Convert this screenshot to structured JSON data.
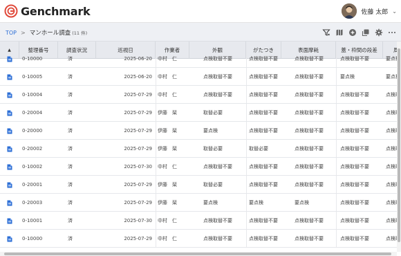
{
  "app": {
    "brand": "Genchmark"
  },
  "user": {
    "name": "佐藤 太郎",
    "caret": "⌄"
  },
  "breadcrumb": {
    "top": "TOP",
    "separator": ">",
    "page": "マンホール調査",
    "count": "(11 件)"
  },
  "toolbar": {
    "icons": [
      "filter-icon",
      "map-icon",
      "add-icon",
      "copy-icon",
      "settings-icon",
      "more-icon"
    ]
  },
  "table": {
    "columns": [
      "▲",
      "整理番号",
      "調査状況",
      "巡視日",
      "作業者",
      "外観",
      "がたつき",
      "表面摩耗",
      "蓋・枠間の段差",
      "周辺"
    ],
    "rows": [
      [
        "0-10000",
        "済",
        "2025-06-20",
        "中村　仁",
        "点検取替不要",
        "点検取替不要",
        "点検取替不要",
        "点検取替不要",
        "要点検"
      ],
      [
        "0-10005",
        "済",
        "2025-06-20",
        "中村　仁",
        "点検取替不要",
        "点検取替不要",
        "点検取替不要",
        "要点検",
        "要点検"
      ],
      [
        "0-10004",
        "済",
        "2025-07-29",
        "中村　仁",
        "点検取替不要",
        "点検取替不要",
        "点検取替不要",
        "点検取替不要",
        "点検取替不要"
      ],
      [
        "0-20004",
        "済",
        "2025-07-29",
        "伊藤　栞",
        "取替必要",
        "点検取替不要",
        "点検取替不要",
        "点検取替不要",
        "点検取替不要"
      ],
      [
        "0-20000",
        "済",
        "2025-07-29",
        "伊藤　栞",
        "要点検",
        "点検取替不要",
        "点検取替不要",
        "点検取替不要",
        "点検取替不要"
      ],
      [
        "0-20002",
        "済",
        "2025-07-29",
        "伊藤　栞",
        "取替必要",
        "取替必要",
        "点検取替不要",
        "点検取替不要",
        "点検取替不要"
      ],
      [
        "0-10002",
        "済",
        "2025-07-30",
        "中村　仁",
        "点検取替不要",
        "点検取替不要",
        "点検取替不要",
        "点検取替不要",
        "点検取替不要"
      ],
      [
        "0-20001",
        "済",
        "2025-07-29",
        "伊藤　栞",
        "取替必要",
        "点検取替不要",
        "点検取替不要",
        "点検取替不要",
        "点検取替不要"
      ],
      [
        "0-20003",
        "済",
        "2025-07-29",
        "伊藤　栞",
        "要点検",
        "要点検",
        "要点検",
        "点検取替不要",
        "点検取替不要"
      ],
      [
        "0-10001",
        "済",
        "2025-07-30",
        "中村　仁",
        "点検取替不要",
        "点検取替不要",
        "点検取替不要",
        "点検取替不要",
        "点検取替不要"
      ],
      [
        "0-10000",
        "済",
        "2025-07-29",
        "中村　仁",
        "点検取替不要",
        "点検取替不要",
        "点検取替不要",
        "点検取替不要",
        "点検取替不要"
      ]
    ]
  },
  "colors": {
    "accent": "#2d6fd6",
    "logo": "#e0493a",
    "header_bg": "#e7e9ee"
  }
}
